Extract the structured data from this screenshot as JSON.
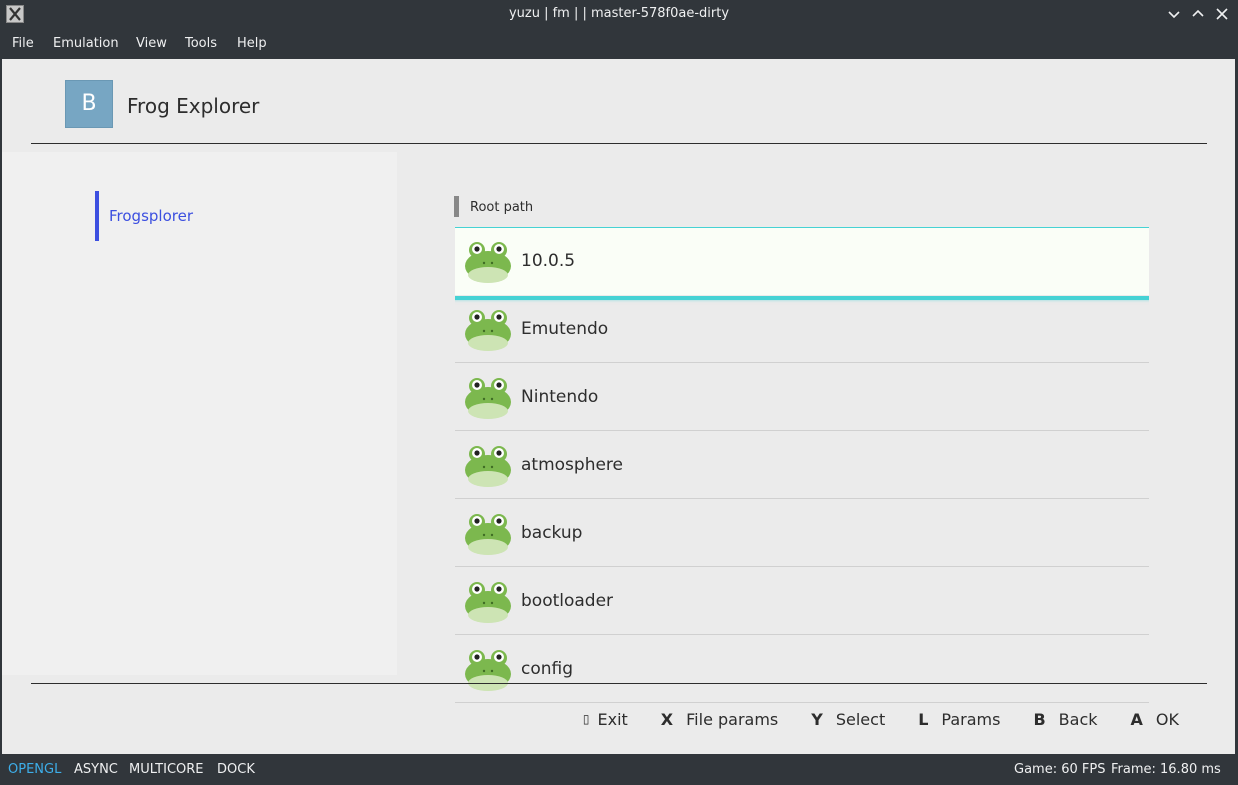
{
  "window": {
    "title": "yuzu | fm | | master-578f0ae-dirty",
    "controls": [
      "minimize-icon",
      "maximize-icon",
      "close-icon"
    ]
  },
  "menu": [
    "File",
    "Emulation",
    "View",
    "Tools",
    "Help"
  ],
  "app": {
    "logo_letter": "B",
    "name": "Frog Explorer"
  },
  "sidebar": {
    "items": [
      {
        "label": "Frogsplorer",
        "active": true
      }
    ]
  },
  "list": {
    "header": "Root path",
    "items": [
      {
        "name": "10.0.5",
        "icon": "frog-icon",
        "selected": true
      },
      {
        "name": "Emutendo",
        "icon": "frog-icon"
      },
      {
        "name": "Nintendo",
        "icon": "frog-icon"
      },
      {
        "name": "atmosphere",
        "icon": "frog-icon"
      },
      {
        "name": "backup",
        "icon": "frog-icon"
      },
      {
        "name": "bootloader",
        "icon": "frog-icon"
      },
      {
        "name": "config",
        "icon": "frog-icon"
      }
    ]
  },
  "hints": [
    {
      "key": "",
      "label": "Exit"
    },
    {
      "key": "X",
      "label": "File params"
    },
    {
      "key": "Y",
      "label": "Select"
    },
    {
      "key": "L",
      "label": "Params"
    },
    {
      "key": "B",
      "label": "Back"
    },
    {
      "key": "A",
      "label": "OK"
    }
  ],
  "status": {
    "left": [
      {
        "label": "OPENGL",
        "active": true
      },
      {
        "label": "ASYNC",
        "active": false
      },
      {
        "label": "MULTICORE",
        "active": false
      },
      {
        "label": "DOCK",
        "active": false
      }
    ],
    "fps": "Game: 60 FPS",
    "frame": "Frame: 16.80 ms"
  },
  "colors": {
    "accent": "#3c4fe0",
    "selection": "#45d2d4",
    "status_active": "#3daee9",
    "frog": "#7cb84e"
  }
}
